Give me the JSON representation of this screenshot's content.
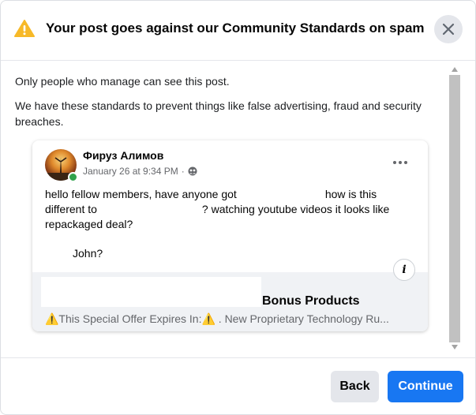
{
  "header": {
    "title": "Your post goes against our Community Standards on spam",
    "warning_icon": "warning-icon",
    "close_icon": "close-icon"
  },
  "body": {
    "notice": "Only people who manage can see this post.",
    "explanation": "We have these standards to prevent things like false advertising, fraud and security breaches."
  },
  "post": {
    "author": "Фируз Алимов",
    "date": "January 26 at 9:34 PM",
    "separator": "·",
    "privacy_icon": "group-icon",
    "more_icon": "more-options-icon",
    "text_part1": "hello fellow members, have anyone got",
    "text_part2": "how is this different to",
    "text_part3": "? watching youtube videos it looks like repackaged deal?",
    "text_line2": "John?",
    "info_icon": "info-icon",
    "info_label": "i",
    "link": {
      "title": "Bonus Products",
      "description": "⚠️This Special Offer Expires In:⚠️ . New Proprietary Technology Ru..."
    }
  },
  "footer": {
    "back_label": "Back",
    "continue_label": "Continue"
  },
  "colors": {
    "primary": "#1877f2",
    "secondary_button": "#e4e6eb",
    "warning": "#f7b928",
    "online": "#31a24c"
  }
}
